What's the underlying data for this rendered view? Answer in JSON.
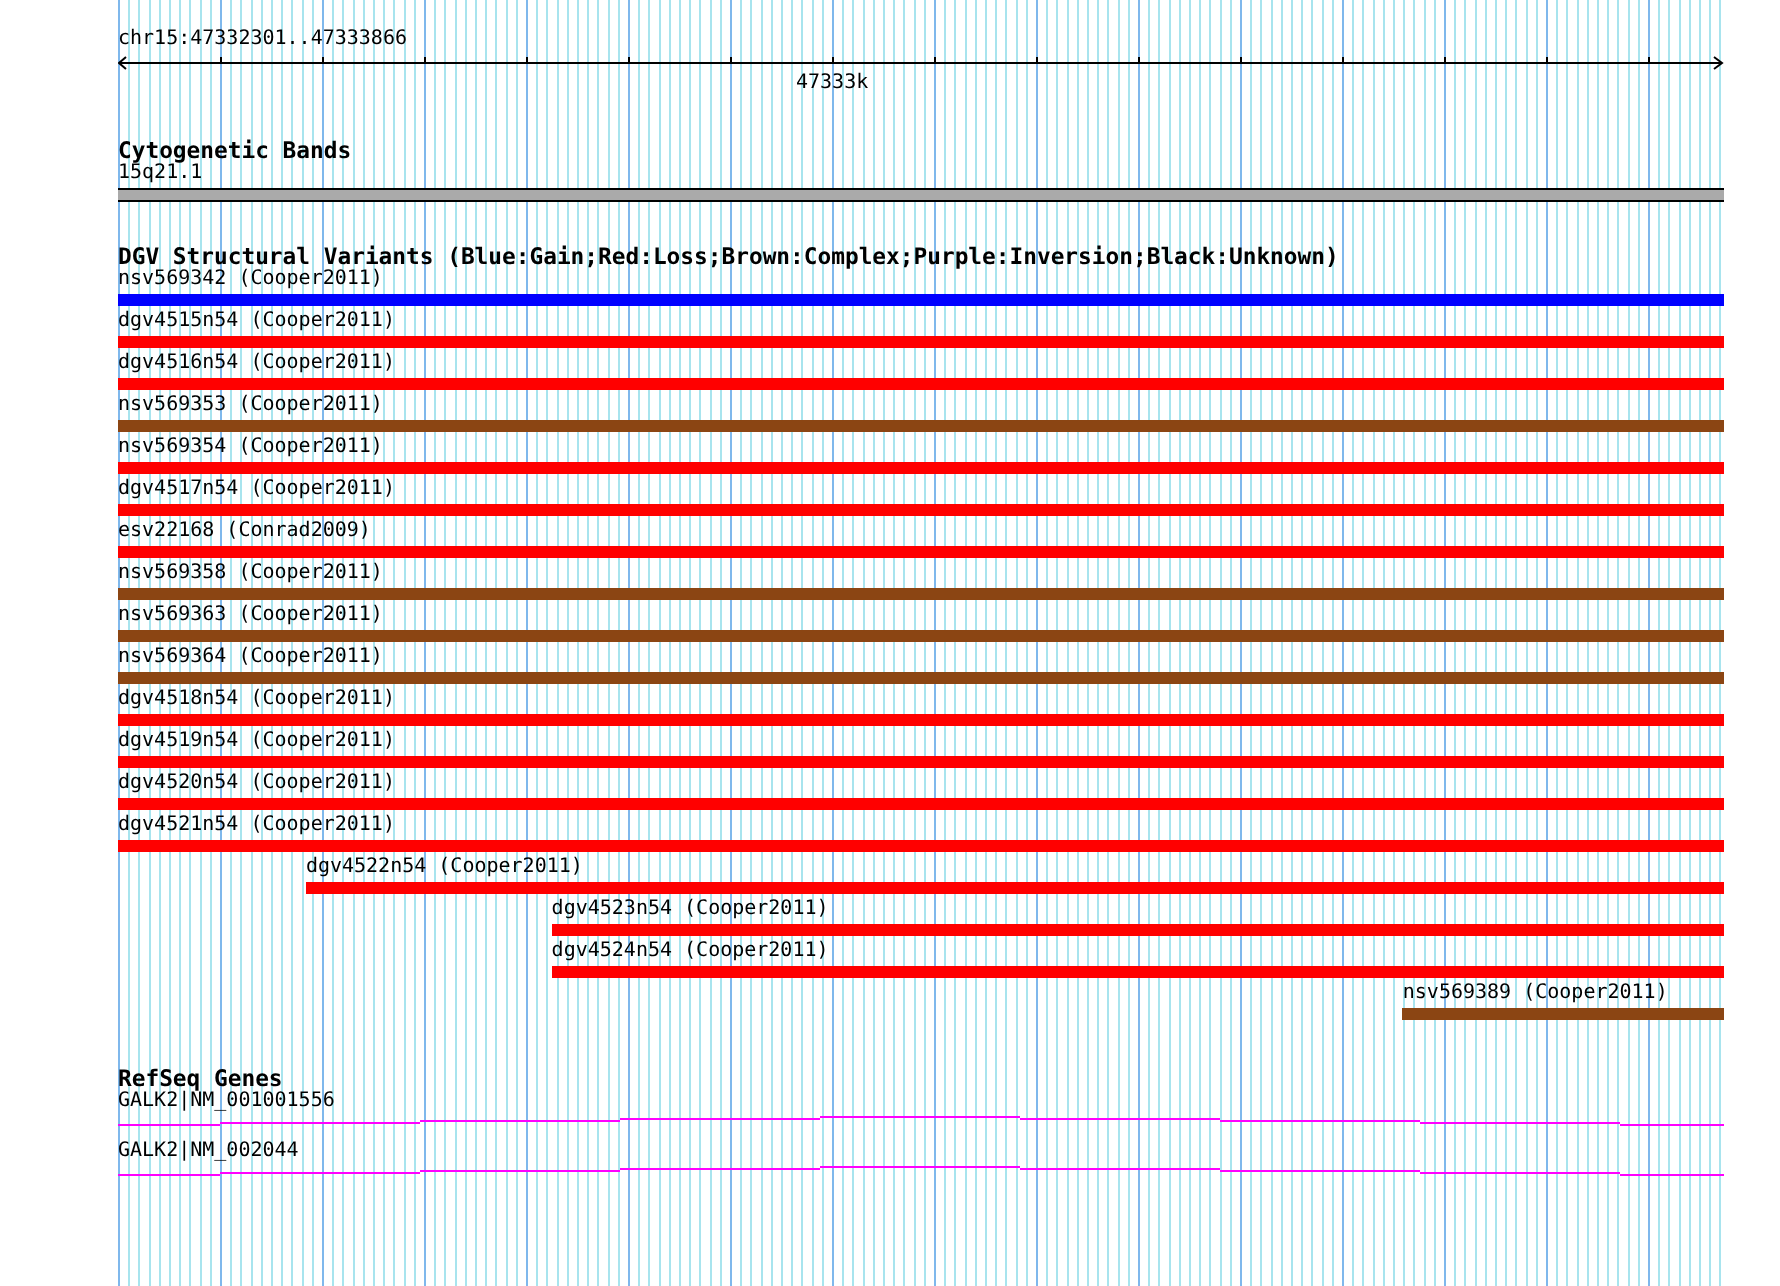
{
  "ruler": {
    "region": "chr15:47332301..47333866",
    "tick_label": "47333k"
  },
  "cytogenetic_bands": {
    "title": "Cytogenetic Bands",
    "band": "15q21.1"
  },
  "dgv": {
    "title": "DGV Structural Variants (Blue:Gain;Red:Loss;Brown:Complex;Purple:Inversion;Black:Unknown)",
    "variants": [
      {
        "label": "nsv569342 (Cooper2011)",
        "color": "#0000ff",
        "level": 1
      },
      {
        "label": "dgv4515n54 (Cooper2011)",
        "color": "#ff0000",
        "level": 1
      },
      {
        "label": "dgv4516n54 (Cooper2011)",
        "color": "#ff0000",
        "level": 1
      },
      {
        "label": "nsv569353 (Cooper2011)",
        "color": "#8b4513",
        "level": 1
      },
      {
        "label": "nsv569354 (Cooper2011)",
        "color": "#ff0000",
        "level": 1
      },
      {
        "label": "dgv4517n54 (Cooper2011)",
        "color": "#ff0000",
        "level": 1
      },
      {
        "label": "esv22168 (Conrad2009)",
        "color": "#ff0000",
        "level": 1
      },
      {
        "label": "nsv569358 (Cooper2011)",
        "color": "#8b4513",
        "level": 1
      },
      {
        "label": "nsv569363 (Cooper2011)",
        "color": "#8b4513",
        "level": 1
      },
      {
        "label": "nsv569364 (Cooper2011)",
        "color": "#8b4513",
        "level": 1
      },
      {
        "label": "dgv4518n54 (Cooper2011)",
        "color": "#ff0000",
        "level": 1
      },
      {
        "label": "dgv4519n54 (Cooper2011)",
        "color": "#ff0000",
        "level": 1
      },
      {
        "label": "dgv4520n54 (Cooper2011)",
        "color": "#ff0000",
        "level": 1
      },
      {
        "label": "dgv4521n54 (Cooper2011)",
        "color": "#ff0000",
        "level": 1
      },
      {
        "label": "dgv4522n54 (Cooper2011)",
        "color": "#ff0000",
        "level": 0.883
      },
      {
        "label": "dgv4523n54 (Cooper2011)",
        "color": "#ff0000",
        "level": 0.73
      },
      {
        "label": "dgv4524n54 (Cooper2011)",
        "color": "#ff0000",
        "level": 0.73
      },
      {
        "label": "nsv569389 (Cooper2011)",
        "color": "#8b4513",
        "level": 0.2
      }
    ]
  },
  "refseq": {
    "title": "RefSeq Genes",
    "genes": [
      {
        "label": "GALK2|NM_001001556"
      },
      {
        "label": "GALK2|NM_002044"
      }
    ]
  }
}
